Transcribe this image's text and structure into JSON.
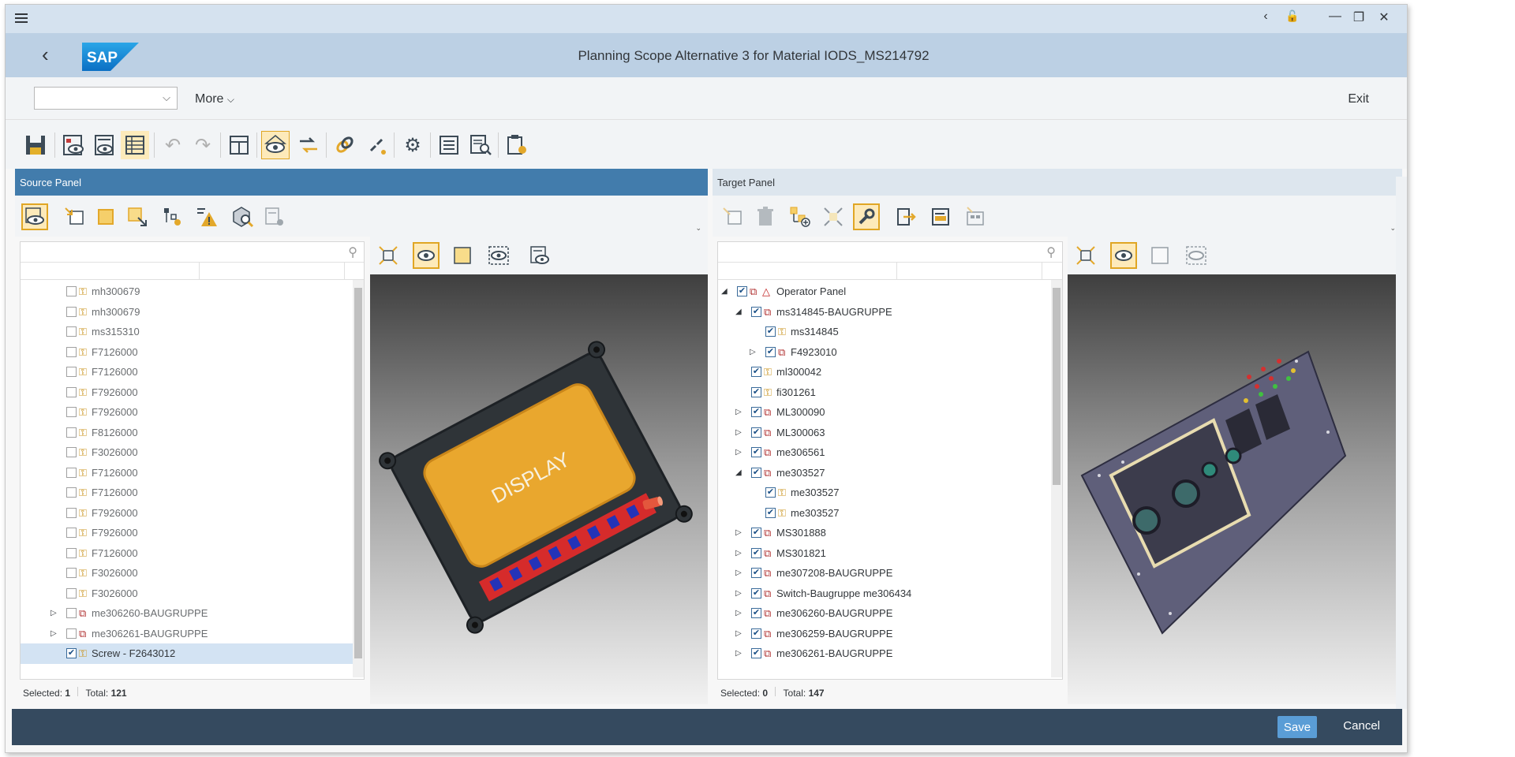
{
  "window": {
    "back_glyph": "‹",
    "lock_glyph": "🔓",
    "minimize_glyph": "—",
    "restore_glyph": "❐",
    "close_glyph": "✕"
  },
  "shell": {
    "title": "Planning Scope Alternative 3 for Material IODS_MS214792",
    "logo_text": "SAP"
  },
  "menubar": {
    "combo_value": "",
    "more_label": "More",
    "exit_label": "Exit"
  },
  "toolbar": {
    "icons": [
      "save-icon",
      "display-object-icon",
      "display-list-icon",
      "table-icon",
      "undo-icon",
      "redo-icon",
      "layout-icon",
      "view-icon",
      "transfer-icon",
      "link-icon",
      "unlink-icon",
      "settings-icon",
      "list-icon",
      "find-list-icon",
      "clipboard-settings-icon"
    ]
  },
  "source_panel": {
    "title": "Source Panel",
    "status_selected_label": "Selected:",
    "status_selected": "1",
    "status_total_label": "Total:",
    "status_total": "121",
    "rows": [
      {
        "label": "mh300679",
        "level": 1,
        "checked": false,
        "type": "part",
        "expand": ""
      },
      {
        "label": "mh300679",
        "level": 1,
        "checked": false,
        "type": "part",
        "expand": ""
      },
      {
        "label": "ms315310",
        "level": 1,
        "checked": false,
        "type": "part",
        "expand": ""
      },
      {
        "label": "F7126000",
        "level": 1,
        "checked": false,
        "type": "part",
        "expand": ""
      },
      {
        "label": "F7126000",
        "level": 1,
        "checked": false,
        "type": "part",
        "expand": ""
      },
      {
        "label": "F7926000",
        "level": 1,
        "checked": false,
        "type": "part",
        "expand": ""
      },
      {
        "label": "F7926000",
        "level": 1,
        "checked": false,
        "type": "part",
        "expand": ""
      },
      {
        "label": "F8126000",
        "level": 1,
        "checked": false,
        "type": "part",
        "expand": ""
      },
      {
        "label": "F3026000",
        "level": 1,
        "checked": false,
        "type": "part",
        "expand": ""
      },
      {
        "label": "F7126000",
        "level": 1,
        "checked": false,
        "type": "part",
        "expand": ""
      },
      {
        "label": "F7126000",
        "level": 1,
        "checked": false,
        "type": "part",
        "expand": ""
      },
      {
        "label": "F7926000",
        "level": 1,
        "checked": false,
        "type": "part",
        "expand": ""
      },
      {
        "label": "F7926000",
        "level": 1,
        "checked": false,
        "type": "part",
        "expand": ""
      },
      {
        "label": "F7126000",
        "level": 1,
        "checked": false,
        "type": "part",
        "expand": ""
      },
      {
        "label": "F3026000",
        "level": 1,
        "checked": false,
        "type": "part",
        "expand": ""
      },
      {
        "label": "F3026000",
        "level": 1,
        "checked": false,
        "type": "part",
        "expand": ""
      },
      {
        "label": "me306260-BAUGRUPPE",
        "level": 1,
        "checked": false,
        "type": "assembly",
        "expand": "▷"
      },
      {
        "label": "me306261-BAUGRUPPE",
        "level": 1,
        "checked": false,
        "type": "assembly",
        "expand": "▷"
      },
      {
        "label": "Screw - F2643012",
        "level": 1,
        "checked": true,
        "type": "part",
        "expand": "",
        "selected": true
      }
    ]
  },
  "target_panel": {
    "title": "Target Panel",
    "status_selected_label": "Selected:",
    "status_selected": "0",
    "status_total_label": "Total:",
    "status_total": "147",
    "rows": [
      {
        "label": "Operator Panel",
        "level": 0,
        "checked": true,
        "type": "root",
        "expand": "◢"
      },
      {
        "label": "ms314845-BAUGRUPPE",
        "level": 1,
        "checked": true,
        "type": "assembly",
        "expand": "◢"
      },
      {
        "label": "ms314845",
        "level": 2,
        "checked": true,
        "type": "part",
        "expand": ""
      },
      {
        "label": "F4923010",
        "level": 2,
        "checked": true,
        "type": "assembly",
        "expand": "▷"
      },
      {
        "label": "ml300042",
        "level": 1,
        "checked": true,
        "type": "part",
        "expand": ""
      },
      {
        "label": "fi301261",
        "level": 1,
        "checked": true,
        "type": "part",
        "expand": ""
      },
      {
        "label": "ML300090",
        "level": 1,
        "checked": true,
        "type": "assembly",
        "expand": "▷"
      },
      {
        "label": "ML300063",
        "level": 1,
        "checked": true,
        "type": "assembly",
        "expand": "▷"
      },
      {
        "label": "me306561",
        "level": 1,
        "checked": true,
        "type": "assembly",
        "expand": "▷"
      },
      {
        "label": "me303527",
        "level": 1,
        "checked": true,
        "type": "assembly",
        "expand": "◢"
      },
      {
        "label": "me303527",
        "level": 2,
        "checked": true,
        "type": "part",
        "expand": ""
      },
      {
        "label": "me303527",
        "level": 2,
        "checked": true,
        "type": "part",
        "expand": ""
      },
      {
        "label": "MS301888",
        "level": 1,
        "checked": true,
        "type": "assembly",
        "expand": "▷"
      },
      {
        "label": "MS301821",
        "level": 1,
        "checked": true,
        "type": "assembly",
        "expand": "▷"
      },
      {
        "label": "me307208-BAUGRUPPE",
        "level": 1,
        "checked": true,
        "type": "assembly",
        "expand": "▷"
      },
      {
        "label": "Switch-Baugruppe me306434",
        "level": 1,
        "checked": true,
        "type": "assembly",
        "expand": "▷"
      },
      {
        "label": "me306260-BAUGRUPPE",
        "level": 1,
        "checked": true,
        "type": "assembly",
        "expand": "▷"
      },
      {
        "label": "me306259-BAUGRUPPE",
        "level": 1,
        "checked": true,
        "type": "assembly",
        "expand": "▷"
      },
      {
        "label": "me306261-BAUGRUPPE",
        "level": 1,
        "checked": true,
        "type": "assembly",
        "expand": "▷"
      }
    ]
  },
  "viewer": {
    "display_label": "DISPLAY"
  },
  "footer": {
    "save_label": "Save",
    "cancel_label": "Cancel"
  },
  "colors": {
    "accent": "#427cac",
    "footer": "#354a5f",
    "save": "#5a9dd6",
    "selected_icon": "#e0a624"
  }
}
